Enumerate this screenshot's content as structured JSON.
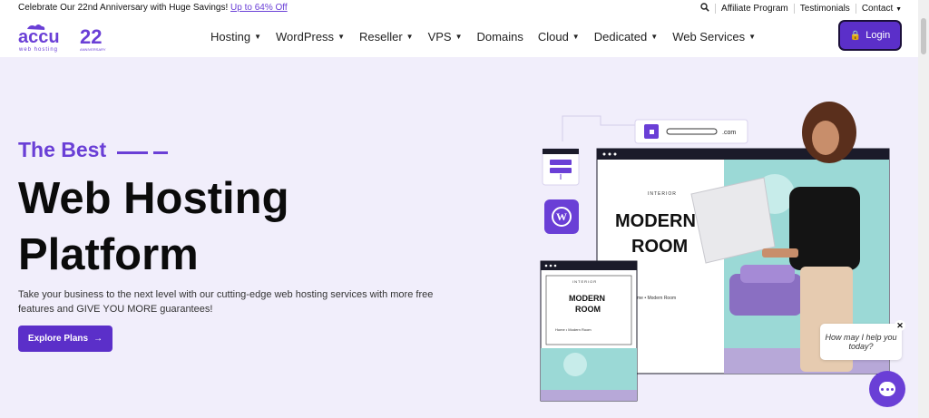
{
  "topbar": {
    "promo_text": "Celebrate Our 22nd Anniversary with Huge Savings!",
    "promo_link": "Up to 64% Off",
    "links": [
      "Affiliate Program",
      "Testimonials",
      "Contact"
    ]
  },
  "brand": {
    "logo_text": "accu",
    "logo_sub": "web hosting",
    "anniversary_number": "22",
    "anniversary_label": "ANNIVERSARY"
  },
  "nav": {
    "items": [
      {
        "label": "Hosting",
        "dropdown": true
      },
      {
        "label": "WordPress",
        "dropdown": true
      },
      {
        "label": "Reseller",
        "dropdown": true
      },
      {
        "label": "VPS",
        "dropdown": true
      },
      {
        "label": "Domains",
        "dropdown": false
      },
      {
        "label": "Cloud",
        "dropdown": true
      },
      {
        "label": "Dedicated",
        "dropdown": true
      },
      {
        "label": "Web Services",
        "dropdown": true
      }
    ],
    "login_label": "Login"
  },
  "hero": {
    "subtitle": "The Best",
    "title_line1": "Web Hosting",
    "title_line2": "Platform",
    "description": "Take your business to the next level with our cutting-edge web hosting services with more free features and GIVE YOU MORE guarantees!",
    "cta_label": "Explore Plans"
  },
  "illustration": {
    "domain_suffix": ".com",
    "big_title_1": "MODERN",
    "big_title_2": "ROOM",
    "big_kicker": "INTERIOR",
    "small_kicker": "INTERIOR",
    "small_title_1": "MODERN",
    "small_title_2": "ROOM",
    "small_breadcrumb": "Home • Modern Room",
    "big_breadcrumb": "me • Modern Room"
  },
  "chat": {
    "prompt": "How may I help you today?"
  },
  "colors": {
    "accent": "#5b2fc9",
    "hero_bg": "#f1eefb"
  }
}
